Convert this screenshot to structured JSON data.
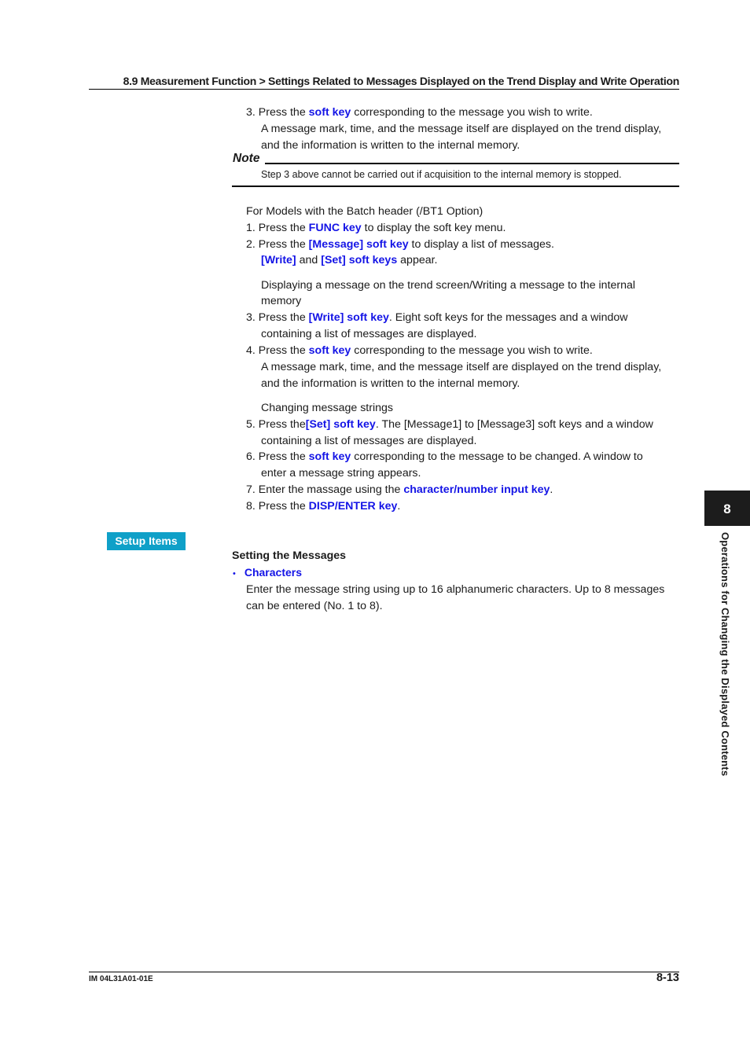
{
  "header": {
    "title": "8.9  Measurement Function > Settings Related to Messages Displayed on the Trend Display and Write Operation"
  },
  "step3_first": {
    "prefix": "3. Press the ",
    "kw": "soft key",
    "suffix": " corresponding to the message you wish to write.",
    "line2": "A message mark, time, and the message itself are displayed on the trend display,",
    "line3": "and the information is written to the internal memory."
  },
  "note": {
    "label": "Note",
    "text": "Step 3 above cannot be carried out if acquisition to the internal memory is stopped."
  },
  "batch": {
    "intro": "For Models with the Batch header (/BT1 Option)",
    "s1": {
      "prefix": "1.  Press the ",
      "kw": "FUNC key",
      "suffix": " to display the soft key menu."
    },
    "s2": {
      "prefix": "2.  Press the ",
      "kw": "[Message] soft key",
      "suffix": " to display a list of messages."
    },
    "s2b": {
      "kw1": "[Write]",
      "mid": " and ",
      "kw2": "[Set] soft keys",
      "suffix": " appear."
    },
    "sub1_line1": "Displaying a message on the trend screen/Writing a message to the internal",
    "sub1_line2": "memory",
    "s3": {
      "prefix": "3. Press the ",
      "kw": "[Write] soft key",
      "suffix": ".  Eight soft keys for the messages and a window",
      "line2": "containing a list of messages are displayed."
    },
    "s4": {
      "prefix": "4.  Press the ",
      "kw": "soft key",
      "suffix": " corresponding to the message you wish to write.",
      "line2": "A message mark, time, and the message itself are displayed on the trend display,",
      "line3": "and the information is written to the internal memory."
    },
    "sub2": "Changing message strings",
    "s5": {
      "prefix": "5.  Press the",
      "kw": "[Set] soft key",
      "suffix": ".  The [Message1] to [Message3] soft keys and a window",
      "line2": "containing a list of messages are displayed."
    },
    "s6": {
      "prefix": "6.  Press the ",
      "kw": "soft key",
      "suffix": " corresponding to the message to be changed. A window to",
      "line2": "enter a message string appears."
    },
    "s7": {
      "prefix": "7.  Enter the massage using the ",
      "kw": "character/number input key",
      "suffix": "."
    },
    "s8": {
      "prefix": "8.  Press the ",
      "kw": "DISP/ENTER key",
      "suffix": "."
    }
  },
  "setup": {
    "badge": "Setup Items",
    "heading": "Setting the Messages",
    "bullet_symbol": "•",
    "bullet_label": "Characters",
    "desc_line1": "Enter the message string using up to 16 alphanumeric characters.  Up to 8 messages",
    "desc_line2": "can be entered (No. 1 to 8)."
  },
  "side_tab": {
    "chapter_number": "8",
    "chapter_title": "Operations for Changing the Displayed Contents"
  },
  "footer": {
    "doc_id": "IM 04L31A01-01E",
    "page_number": "8-13"
  },
  "colors": {
    "keyword": "#1414e6",
    "badge_bg": "#0fa0c8",
    "tab_bg": "#1c1c1c"
  }
}
